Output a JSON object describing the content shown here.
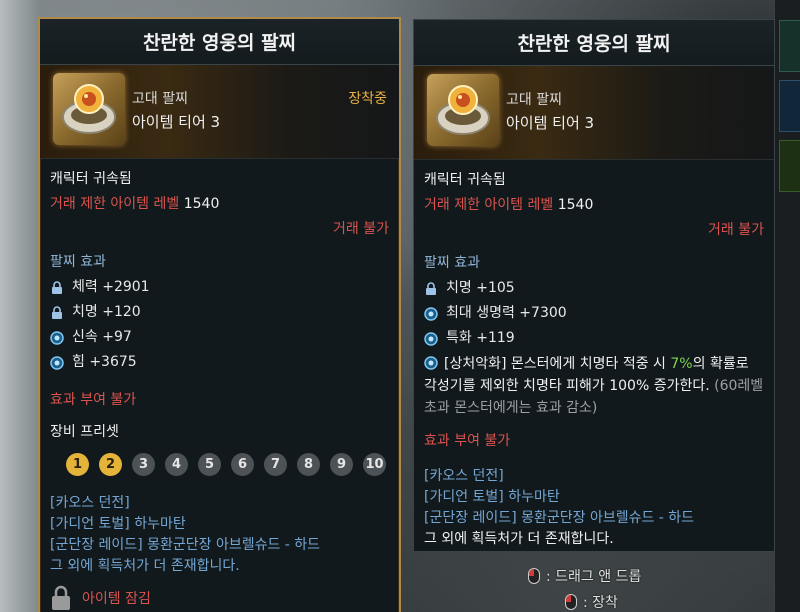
{
  "colors": {
    "gold_border": "#b08a4a",
    "equipped": "#e8b043",
    "restriction_red": "#d9534f",
    "section_blue": "#8fb4d6",
    "source_blue": "#74a6d3",
    "active_preset": "#e3b33a",
    "highlight_green": "#7fd44f"
  },
  "left_tooltip": {
    "title": "찬란한 영웅의 팔찌",
    "grade": "고대 팔찌",
    "tier": "아이템 티어 3",
    "equipped_label": "장착중",
    "bound": "캐릭터 귀속됨",
    "level_label": "거래 제한 아이템 레벨",
    "level_value": "1540",
    "trade": "거래 불가",
    "effect_title": "팔찌 효과",
    "stats": [
      {
        "icon": "lock-icon",
        "text": "체력 +2901"
      },
      {
        "icon": "lock-icon",
        "text": "치명 +120"
      },
      {
        "icon": "gem-icon",
        "text": "신속 +97"
      },
      {
        "icon": "gem-icon",
        "text": "힘 +3675"
      }
    ],
    "enchant": "효과 부여 불가",
    "preset_title": "장비 프리셋",
    "presets": [
      {
        "label": "1",
        "active": true
      },
      {
        "label": "2",
        "active": true
      },
      {
        "label": "3",
        "active": false
      },
      {
        "label": "4",
        "active": false
      },
      {
        "label": "5",
        "active": false
      },
      {
        "label": "6",
        "active": false
      },
      {
        "label": "7",
        "active": false
      },
      {
        "label": "8",
        "active": false
      },
      {
        "label": "9",
        "active": false
      },
      {
        "label": "10",
        "active": false
      }
    ],
    "sources": [
      "[카오스 던전]",
      "[가디언 토벌] 하누마탄",
      "[군단장 레이드] 몽환군단장 아브렐슈드 - 하드"
    ],
    "sources_more": "그 외에 획득처가 더 존재합니다.",
    "lock_label": "아이템 잠김"
  },
  "right_tooltip": {
    "title": "찬란한 영웅의 팔찌",
    "grade": "고대 팔찌",
    "tier": "아이템 티어 3",
    "bound": "캐릭터 귀속됨",
    "level_label": "거래 제한 아이템 레벨",
    "level_value": "1540",
    "trade": "거래 불가",
    "effect_title": "팔찌 효과",
    "stats": [
      {
        "icon": "lock-icon",
        "text": "치명 +105"
      },
      {
        "icon": "gem-icon",
        "text": "최대 생명력 +7300"
      },
      {
        "icon": "gem-icon",
        "text": "특화 +119"
      }
    ],
    "special_tag": "[상처악화]",
    "special_a": " 몬스터에게 치명타 적중 시 ",
    "special_pct": "7%",
    "special_b": "의 확률로 각성기를 제외한 치명타 피해가 100% 증가한다.",
    "special_note": " (60레벨 초과 몬스터에게는 효과 감소)",
    "enchant": "효과 부여 불가",
    "sources": [
      "[카오스 던전]",
      "[가디언 토벌] 하누마탄",
      "[군단장 레이드] 몽환군단장 아브렐슈드 - 하드"
    ],
    "sources_more": "그 외에 획득처가 더 존재합니다."
  },
  "hints": {
    "drag": ": 드래그 앤 드롭",
    "equip": ": 장착"
  }
}
